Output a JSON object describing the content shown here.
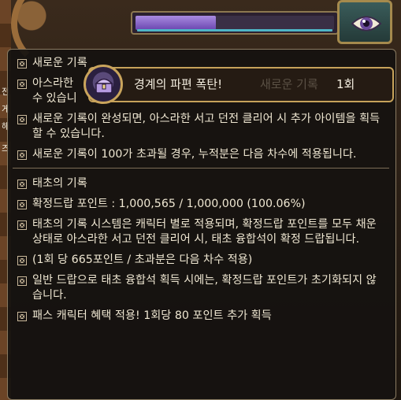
{
  "sidebar_text": [
    "전",
    "게",
    "해",
    "즈"
  ],
  "hud": {
    "progress_fraction": 0.4
  },
  "tooltip": {
    "section1": {
      "header": "새로운 기록",
      "item1": "아스라한 서고 던전 클리어 시 새로운 기록을 작성할 수 있습니다.",
      "item1_visible": "아스라한",
      "item1_line2": "수 있습니",
      "item2": "새로운 기록이 완성되면, 아스라한 서고 던전 클리어 시 추가 아이템을 획득할 수 있습니다.",
      "item3": "새로운 기록이 100가 초과될 경우, 누적분은 다음 차수에 적용됩니다."
    },
    "section2": {
      "header": "태초의 기록",
      "points_line": "확정드랍 포인트 : 1,000,565 / 1,000,000 (100.06%)",
      "item1": "태초의 기록 시스템은 캐릭터 별로 적용되며, 확정드랍 포인트를 모두 채운 상태로 아스라한 서고 던전 클리어 시, 태초 융합석이 확정 드랍됩니다.",
      "item2": "(1회 당 665포인트 / 초과분은 다음 차수 적용)",
      "item3": "일반 드랍으로 태초 융합석 획득 시에는, 확정드랍 포인트가 초기화되지 않습니다.",
      "item4": "패스 캐릭터 혜택 적용! 1회당 80 포인트 추가 획득"
    }
  },
  "popup": {
    "title": "경계의 파편 폭탄!",
    "faded_text": "새로운 기록",
    "count": "1회"
  },
  "colors": {
    "tooltip_bg": "#161210",
    "text": "#efe7d2",
    "bullet": "#c9b89a",
    "popup_border": "#c6a25a",
    "hud_fill": "#8a6ad0"
  }
}
